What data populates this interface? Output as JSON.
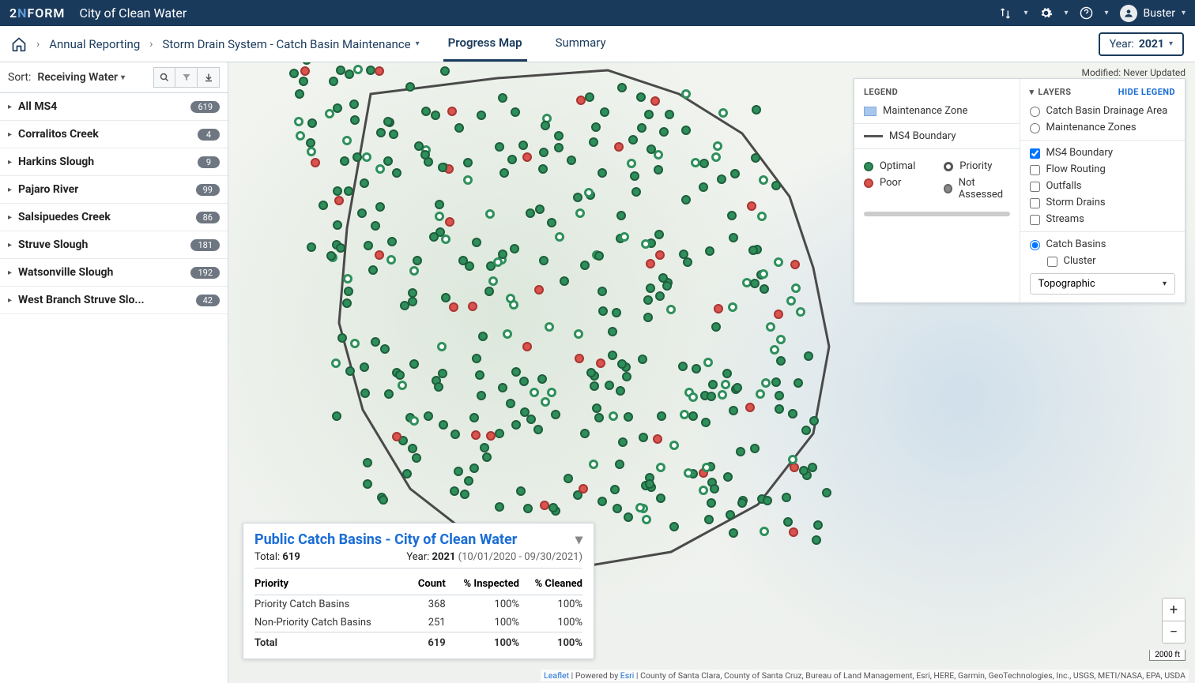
{
  "app": {
    "logo_two": "2",
    "logo_n": "N",
    "logo_form": "FORM",
    "city": "City of Clean Water",
    "user": "Buster"
  },
  "breadcrumb": {
    "items": [
      "Annual Reporting",
      "Storm Drain System - Catch Basin Maintenance"
    ],
    "tabs": [
      "Progress Map",
      "Summary"
    ],
    "active_tab": 0,
    "year_label": "Year:",
    "year_value": "2021"
  },
  "modified": "Modified: Never Updated",
  "sort": {
    "label": "Sort:",
    "value": "Receiving Water"
  },
  "sidebar": {
    "items": [
      {
        "name": "All MS4",
        "count": "619"
      },
      {
        "name": "Corralitos Creek",
        "count": "4"
      },
      {
        "name": "Harkins Slough",
        "count": "9"
      },
      {
        "name": "Pajaro River",
        "count": "99"
      },
      {
        "name": "Salsipuedes Creek",
        "count": "86"
      },
      {
        "name": "Struve Slough",
        "count": "181"
      },
      {
        "name": "Watsonville Slough",
        "count": "192"
      },
      {
        "name": "West Branch Struve Slo...",
        "count": "42"
      }
    ]
  },
  "legend": {
    "title": "LEGEND",
    "hide": "HIDE LEGEND",
    "maint_zone": "Maintenance Zone",
    "boundary": "MS4 Boundary",
    "status": {
      "optimal": "Optimal",
      "poor": "Poor",
      "priority": "Priority",
      "not_assessed": "Not Assessed"
    },
    "layers_title": "LAYERS",
    "layers": {
      "cbda": "Catch Basin Drainage Area",
      "mz": "Maintenance Zones",
      "ms4": "MS4 Boundary",
      "flow": "Flow Routing",
      "outfalls": "Outfalls",
      "storm": "Storm Drains",
      "streams": "Streams",
      "cb": "Catch Basins",
      "cluster": "Cluster"
    },
    "basemap": "Topographic"
  },
  "summary": {
    "title": "Public Catch Basins - City of Clean Water",
    "total_label": "Total:",
    "total_value": "619",
    "year_label": "Year:",
    "year_value": "2021",
    "range": "(10/01/2020 - 09/30/2021)",
    "headers": {
      "priority": "Priority",
      "count": "Count",
      "inspected": "% Inspected",
      "cleaned": "% Cleaned"
    },
    "rows": [
      {
        "name": "Priority Catch Basins",
        "count": "368",
        "inspected": "100%",
        "cleaned": "100%"
      },
      {
        "name": "Non-Priority Catch Basins",
        "count": "251",
        "inspected": "100%",
        "cleaned": "100%"
      }
    ],
    "total_row": {
      "name": "Total",
      "count": "619",
      "inspected": "100%",
      "cleaned": "100%"
    }
  },
  "attribution": {
    "leaflet": "Leaflet",
    "powered": " | Powered by ",
    "esri": "Esri",
    "rest": " | County of Santa Clara, County of Santa Cruz, Bureau of Land Management, Esri, HERE, Garmin, GeoTechnologies, Inc., USGS, METI/NASA, EPA, USDA"
  },
  "scale": "2000 ft"
}
